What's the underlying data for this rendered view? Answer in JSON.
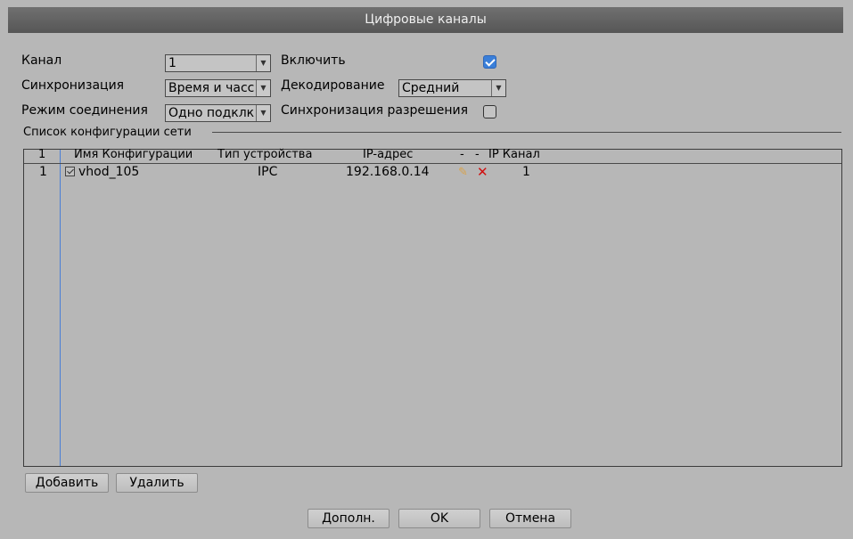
{
  "window": {
    "title": "Цифровые каналы"
  },
  "form": {
    "channel_label": "Канал",
    "channel_value": "1",
    "enable_label": "Включить",
    "enable_checked": true,
    "sync_label": "Синхронизация",
    "sync_value": "Время и часс",
    "decode_label": "Декодирование",
    "decode_value": "Средний",
    "conn_mode_label": "Режим соединения",
    "conn_mode_value": "Одно подклк",
    "res_sync_label": "Синхронизация разрешения",
    "res_sync_checked": false
  },
  "network_list": {
    "group_title": "Список конфигурации сети",
    "headers": {
      "index": "1",
      "name": "Имя Конфигурации",
      "device_type": "Тип устройства",
      "ip": "IP-адрес",
      "dash1": "-",
      "dash2": "-",
      "ip_channel": "IP Канал"
    },
    "rows": [
      {
        "index": "1",
        "name": "vhod_105",
        "device_type": "IPC",
        "ip": "192.168.0.14",
        "ip_channel": "1"
      }
    ]
  },
  "list_buttons": {
    "add": "Добавить",
    "delete": "Удалить"
  },
  "footer_buttons": {
    "advanced": "Дополн.",
    "ok": "OK",
    "cancel": "Отмена"
  },
  "colors": {
    "titlebar": "#5e5e5e",
    "background": "#b7b7b7",
    "checkbox_on": "#3a7fd9",
    "delete_icon": "#d01010",
    "edit_icon": "#d9a24a"
  }
}
